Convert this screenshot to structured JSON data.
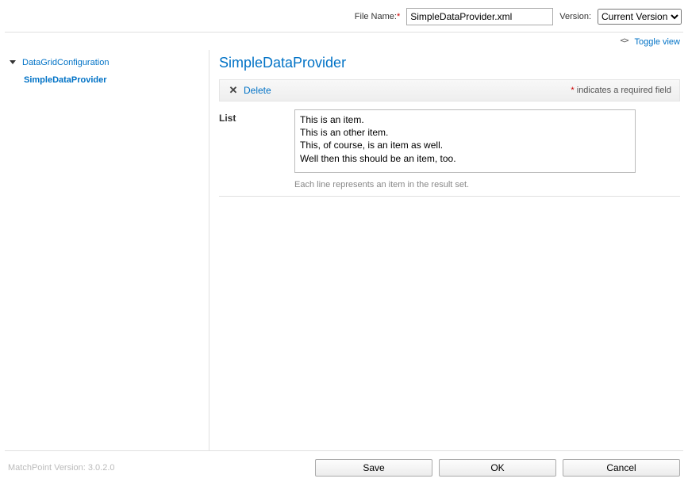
{
  "header": {
    "filename_label": "File Name:",
    "filename_value": "SimpleDataProvider.xml",
    "version_label": "Version:",
    "version_selected": "Current Version"
  },
  "toggle": {
    "label": "Toggle view"
  },
  "sidebar": {
    "root": "DataGridConfiguration",
    "child": "SimpleDataProvider"
  },
  "main": {
    "title": "SimpleDataProvider",
    "delete_label": "Delete",
    "required_note": "indicates a required field",
    "list_label": "List",
    "list_value": "This is an item.\nThis is an other item.\nThis, of course, is an item as well.\nWell then this should be an item, too.",
    "list_hint": "Each line represents an item in the result set."
  },
  "footer": {
    "version_text": "MatchPoint Version: 3.0.2.0",
    "save": "Save",
    "ok": "OK",
    "cancel": "Cancel"
  }
}
